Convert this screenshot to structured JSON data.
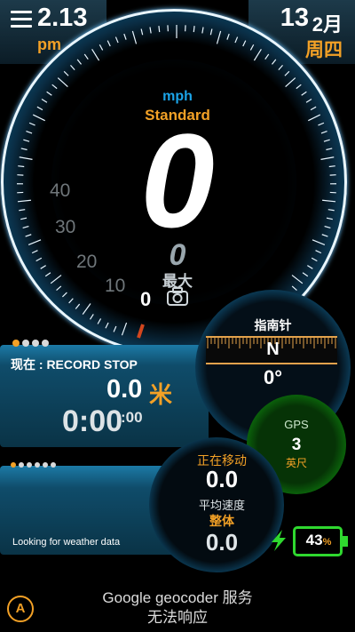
{
  "header": {
    "time": "2.13",
    "ampm": "pm",
    "day": "13",
    "month": "2月",
    "weekday": "周四"
  },
  "speedometer": {
    "unit": "mph",
    "mode": "Standard",
    "speed": "0",
    "max_value": "0",
    "max_label": "最大",
    "scale_labels": [
      "40",
      "30",
      "20",
      "10"
    ],
    "current_marker": "0"
  },
  "trip": {
    "status": "现在 : RECORD STOP",
    "distance": "0.0",
    "distance_unit": "米",
    "duration": "0:00",
    "duration_seconds": ":00"
  },
  "compass": {
    "label": "指南针",
    "heading": "N",
    "degrees": "0°"
  },
  "gps": {
    "label": "GPS",
    "accuracy": "3",
    "unit": "英尺"
  },
  "moving": {
    "label": "正在移动",
    "value": "0.0",
    "avg_label": "平均速度",
    "avg_sub": "整体",
    "avg_value": "0.0"
  },
  "weather": {
    "text": "Looking for weather data"
  },
  "battery": {
    "value": "43",
    "unit": "%"
  },
  "footer": {
    "line1": "Google geocoder 服务",
    "line2": "无法响应",
    "auto_button": "A"
  },
  "colors": {
    "accent": "#f3a126",
    "dial": "#1aa4d9",
    "gps": "#25e825"
  },
  "icons": [
    "menu-icon",
    "camera-icon",
    "charging-bolt-icon"
  ]
}
